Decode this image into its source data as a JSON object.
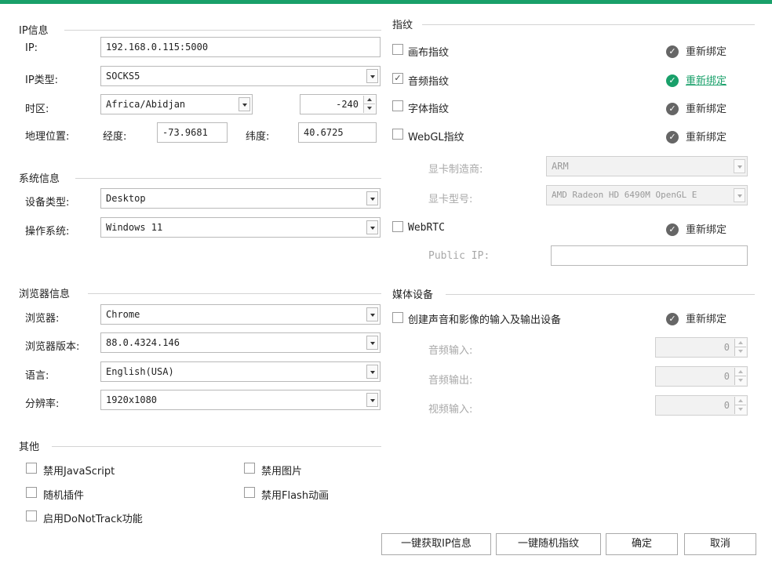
{
  "ip_section": {
    "title": "IP信息",
    "ip_label": "IP:",
    "ip_value": "192.168.0.115:5000",
    "ip_type_label": "IP类型:",
    "ip_type_value": "SOCKS5",
    "timezone_label": "时区:",
    "timezone_value": "Africa/Abidjan",
    "timezone_offset": "-240",
    "location_label": "地理位置:",
    "longitude_label": "经度:",
    "longitude_value": "-73.9681",
    "latitude_label": "纬度:",
    "latitude_value": "40.6725"
  },
  "system_section": {
    "title": "系统信息",
    "device_type_label": "设备类型:",
    "device_type_value": "Desktop",
    "os_label": "操作系统:",
    "os_value": "Windows 11"
  },
  "browser_section": {
    "title": "浏览器信息",
    "browser_label": "浏览器:",
    "browser_value": "Chrome",
    "version_label": "浏览器版本:",
    "version_value": "88.0.4324.146",
    "language_label": "语言:",
    "language_value": "English(USA)",
    "resolution_label": "分辨率:",
    "resolution_value": "1920x1080"
  },
  "other_section": {
    "title": "其他",
    "disable_js": "禁用JavaScript",
    "disable_images": "禁用图片",
    "random_plugins": "随机插件",
    "disable_flash": "禁用Flash动画",
    "enable_dnt": "启用DoNotTrack功能"
  },
  "fingerprint_section": {
    "title": "指纹",
    "canvas": "画布指纹",
    "audio": "音频指纹",
    "font": "字体指纹",
    "webgl": "WebGL指纹",
    "gpu_vendor_label": "显卡制造商:",
    "gpu_vendor_value": "ARM",
    "gpu_model_label": "显卡型号:",
    "gpu_model_value": "AMD Radeon HD 6490M OpenGL E",
    "webrtc": "WebRTC",
    "public_ip_label": "Public IP:",
    "public_ip_value": "",
    "rebind": "重新绑定",
    "audio_checked": "✓"
  },
  "media_section": {
    "title": "媒体设备",
    "create_devices": "创建声音和影像的输入及输出设备",
    "audio_in_label": "音频输入:",
    "audio_in_value": "0",
    "audio_out_label": "音频输出:",
    "audio_out_value": "0",
    "video_in_label": "视频输入:",
    "video_in_value": "0"
  },
  "buttons": {
    "fetch_ip": "一键获取IP信息",
    "random_fp": "一键随机指纹",
    "confirm": "确定",
    "cancel": "取消"
  },
  "colors": {
    "accent": "#19a06a",
    "icon_gray": "#666666"
  }
}
